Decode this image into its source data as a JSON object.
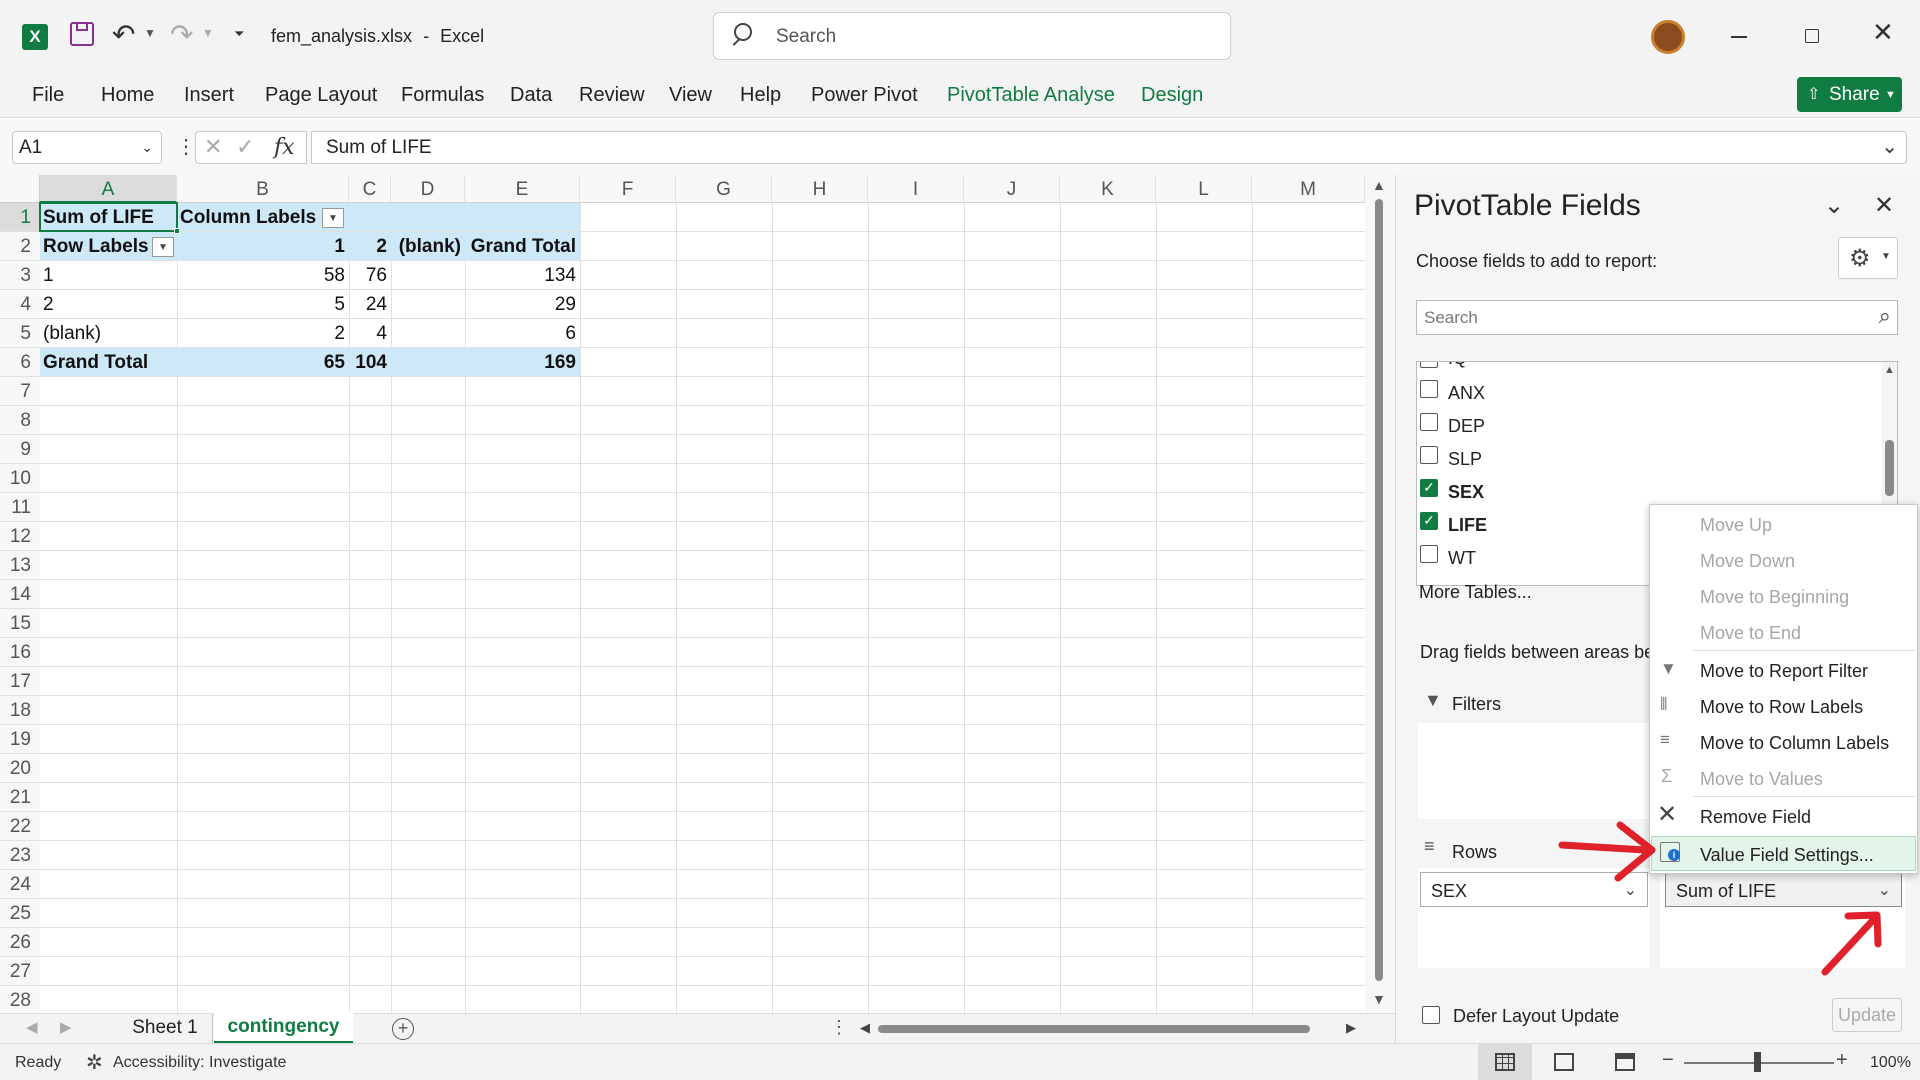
{
  "window": {
    "filename": "fem_analysis.xlsx",
    "separator": "-",
    "app": "Excel",
    "search_placeholder": "Search"
  },
  "ribbon": {
    "tabs": [
      "File",
      "Home",
      "Insert",
      "Page Layout",
      "Formulas",
      "Data",
      "Review",
      "View",
      "Help",
      "Power Pivot",
      "PivotTable Analyse",
      "Design"
    ],
    "share_label": "Share"
  },
  "formula": {
    "name_box": "A1",
    "fx": "fx",
    "content": "Sum of LIFE"
  },
  "grid": {
    "columns": [
      "A",
      "B",
      "C",
      "D",
      "E",
      "F",
      "G",
      "H",
      "I",
      "J",
      "K",
      "L",
      "M"
    ],
    "rows": [
      "1",
      "2",
      "3",
      "4",
      "5",
      "6",
      "7",
      "8",
      "9",
      "10",
      "11",
      "12",
      "13",
      "14",
      "15",
      "16",
      "17",
      "18",
      "19",
      "20",
      "21",
      "22",
      "23",
      "24",
      "25",
      "26",
      "27",
      "28"
    ],
    "pivot": {
      "a1": "Sum of LIFE",
      "b1": "Column Labels",
      "a2": "Row Labels",
      "b2": "1",
      "c2": "2",
      "d2": "(blank)",
      "e2": "Grand Total",
      "r3": [
        "1",
        "58",
        "76",
        "134"
      ],
      "r4": [
        "2",
        "5",
        "24",
        "29"
      ],
      "r5": [
        "(blank)",
        "2",
        "4",
        "6"
      ],
      "r6": [
        "Grand Total",
        "65",
        "104",
        "169"
      ]
    }
  },
  "sheets": {
    "tabs": [
      "Sheet 1",
      "contingency"
    ],
    "active": "contingency"
  },
  "status": {
    "ready": "Ready",
    "accessibility": "Accessibility: Investigate",
    "zoom": "100%"
  },
  "pane": {
    "title": "PivotTable Fields",
    "choose": "Choose fields to add to report:",
    "search_placeholder": "Search",
    "fields": [
      {
        "name": "IQ",
        "checked": false
      },
      {
        "name": "ANX",
        "checked": false
      },
      {
        "name": "DEP",
        "checked": false
      },
      {
        "name": "SLP",
        "checked": false
      },
      {
        "name": "SEX",
        "checked": true
      },
      {
        "name": "LIFE",
        "checked": true
      },
      {
        "name": "WT",
        "checked": false
      }
    ],
    "more_tables": "More Tables...",
    "drag_text": "Drag fields between areas be",
    "filters": "Filters",
    "rows": "Rows",
    "rows_field": "SEX",
    "values_field": "Sum of LIFE",
    "defer": "Defer Layout Update",
    "update": "Update"
  },
  "context_menu": {
    "items": [
      {
        "label": "Move Up",
        "disabled": true
      },
      {
        "label": "Move Down",
        "disabled": true
      },
      {
        "label": "Move to Beginning",
        "disabled": true
      },
      {
        "label": "Move to End",
        "disabled": true
      },
      {
        "label": "Move to Report Filter",
        "disabled": false
      },
      {
        "label": "Move to Row Labels",
        "disabled": false
      },
      {
        "label": "Move to Column Labels",
        "disabled": false
      },
      {
        "label": "Move to Values",
        "disabled": true
      },
      {
        "label": "Remove Field",
        "disabled": false
      },
      {
        "label": "Value Field Settings...",
        "disabled": false
      }
    ]
  },
  "colors": {
    "accent": "#107c41",
    "pivot_highlight": "#cde8f7",
    "annotation": "#e0202a"
  }
}
